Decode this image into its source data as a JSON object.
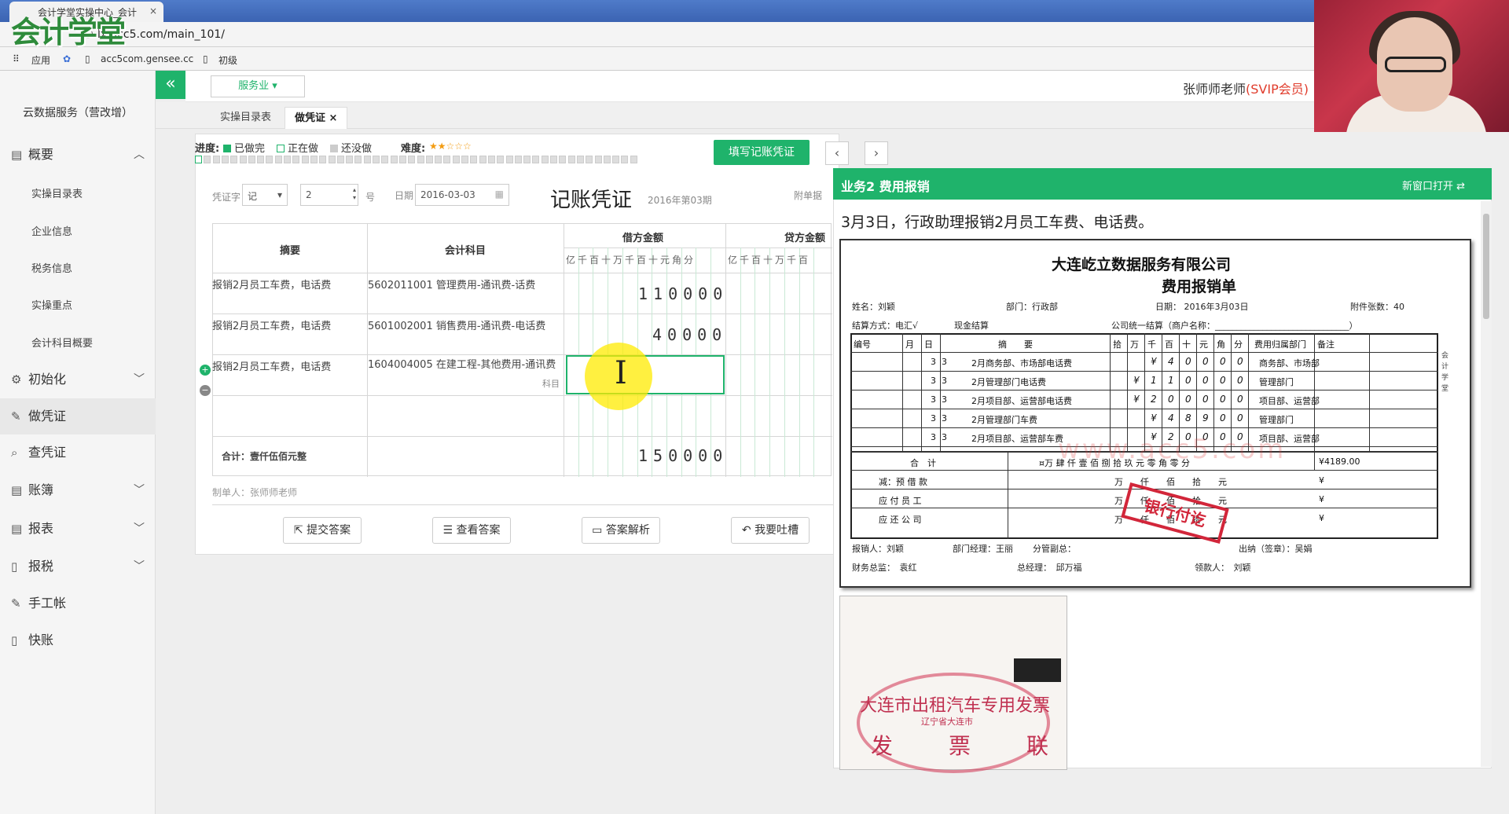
{
  "browser": {
    "tab_title": "会计学堂实操中心_会计",
    "tab_close": "×",
    "url": "lx.acc5.com/main_101/",
    "bookmarks": [
      "应用",
      "acc5com.gensee.cc",
      "初级"
    ]
  },
  "logo_text": "会计学堂",
  "sidebar": {
    "collapse": "«",
    "title": "云数据服务（营改增）",
    "items": [
      {
        "label": "概要",
        "icon": "▤",
        "chev": "︿"
      },
      {
        "label": "初始化",
        "icon": "⚙",
        "chev": "﹀"
      },
      {
        "label": "做凭证",
        "icon": "✎",
        "chev": ""
      },
      {
        "label": "查凭证",
        "icon": "⌕",
        "chev": ""
      },
      {
        "label": "账簿",
        "icon": "▤",
        "chev": "﹀"
      },
      {
        "label": "报表",
        "icon": "▤",
        "chev": "﹀"
      },
      {
        "label": "报税",
        "icon": "▯",
        "chev": "﹀"
      },
      {
        "label": "手工帐",
        "icon": "✎",
        "chev": ""
      },
      {
        "label": "快账",
        "icon": "▯",
        "chev": ""
      }
    ],
    "subitems": [
      "实操目录表",
      "企业信息",
      "税务信息",
      "实操重点",
      "会计科目概要"
    ]
  },
  "header": {
    "service": "服务业 ▾",
    "user_name": "张师师老师",
    "user_vip": "(SVIP会员)"
  },
  "page_tabs": [
    "实操目录表",
    "做凭证 ×"
  ],
  "progress": {
    "label": "进度:",
    "done": "已做完",
    "doing": "正在做",
    "todo": "还没做",
    "difficulty_label": "难度:",
    "difficulty_stars": "★★☆☆☆",
    "colors": {
      "done": "#1fb36b",
      "doing": "#ffffff",
      "todo": "#cccccc",
      "star": "#f39c12"
    }
  },
  "fill_button": "填写记账凭证",
  "nav_prev": "‹",
  "nav_next": "›",
  "voucher": {
    "type_label": "凭证字",
    "type_value": "记",
    "number_value": "2",
    "number_unit": "号",
    "date_label": "日期",
    "date_value": "2016-03-03",
    "title": "记账凭证",
    "period": "2016年第03期",
    "attach_label": "附单据",
    "col_summary": "摘要",
    "col_account": "会计科目",
    "col_debit": "借方金额",
    "col_credit": "贷方金额",
    "debit_digits": "亿千百十万千百十元角分",
    "credit_digits": "亿千百十万千百",
    "rows": [
      {
        "summary": "报销2月员工车费，电话费",
        "account": "5602011001 管理费用-通讯费-话费",
        "debit": "110000"
      },
      {
        "summary": "报销2月员工车费，电话费",
        "account": "5601002001 销售费用-通讯费-电话费",
        "debit": "40000"
      },
      {
        "summary": "报销2月员工车费，电话费",
        "account": "1604004005 在建工程-其他费用-通讯费",
        "debit": "",
        "account_sub": "科目"
      }
    ],
    "total_label": "合计：壹仟伍佰元整",
    "total_debit": "150000",
    "maker": "制单人：张师师老师"
  },
  "action_buttons": [
    "提交答案",
    "查看答案",
    "答案解析",
    "我要吐槽"
  ],
  "task": {
    "title": "业务2 费用报销",
    "open_new": "新窗口打开 ⇄",
    "description": "3月3日，行政助理报销2月员工车费、电话费。"
  },
  "receipt": {
    "company": "大连屹立数据服务有限公司",
    "title": "费用报销单",
    "name": "姓名：刘颖",
    "dept": "部门：行政部",
    "date": "日期： 2016年3月03日",
    "attach": "附件张数：40",
    "settle": "结算方式：电汇√",
    "cash": "现金结算",
    "company_settle": "公司统一结算（商户名称：_______________________________）",
    "headers": [
      "编号",
      "月",
      "日",
      "摘　　要",
      "拾",
      "万",
      "千",
      "百",
      "十",
      "元",
      "角",
      "分",
      "费用归属部门",
      "备注"
    ],
    "rows": [
      {
        "m": "3",
        "d": "3",
        "summary": "2月商务部、市场部电话费",
        "amt": [
          "",
          "",
          "¥",
          "4",
          "0",
          "0",
          "0",
          "0"
        ],
        "dept": "商务部、市场部"
      },
      {
        "m": "3",
        "d": "3",
        "summary": "2月管理部门电话费",
        "amt": [
          "",
          "¥",
          "1",
          "1",
          "0",
          "0",
          "0",
          "0"
        ],
        "dept": "管理部门"
      },
      {
        "m": "3",
        "d": "3",
        "summary": "2月项目部、运营部电话费",
        "amt": [
          "",
          "¥",
          "2",
          "0",
          "0",
          "0",
          "0",
          "0"
        ],
        "dept": "项目部、运营部"
      },
      {
        "m": "3",
        "d": "3",
        "summary": "2月管理部门车费",
        "amt": [
          "",
          "",
          "¥",
          "4",
          "8",
          "9",
          "0",
          "0"
        ],
        "dept": "管理部门"
      },
      {
        "m": "3",
        "d": "3",
        "summary": "2月项目部、运营部车费",
        "amt": [
          "",
          "",
          "¥",
          "2",
          "0",
          "0",
          "0",
          "0"
        ],
        "dept": "项目部、运营部"
      }
    ],
    "total_label": "合　计",
    "total_words": "¤万 肆 仟 壹 佰 捌 拾 玖 元 零 角 零 分",
    "total_amount": "¥4189.00",
    "less_advance": "减：预 借 款",
    "pay_staff": "应 付 员 工",
    "refund": "应 还 公 司",
    "units": "万　　仟　　佰　　拾　　元",
    "yen": "¥",
    "approver": "报销人：刘颖",
    "dept_manager": "部门经理：王丽",
    "vp": "分管副总：",
    "cashier": "出纳（签章）：吴娟",
    "fin_director": "财务总监：　袁红",
    "gm": "总经理：　邱万福",
    "receiver": "领款人：　刘颖",
    "stamp": "银行付讫",
    "watermark": "www.acc5.com",
    "side_text": "会计学堂"
  },
  "invoice": {
    "title": "大连市出租汽车专用发票",
    "sub": "辽宁省大连市",
    "fp": [
      "发",
      "票",
      "联"
    ]
  }
}
